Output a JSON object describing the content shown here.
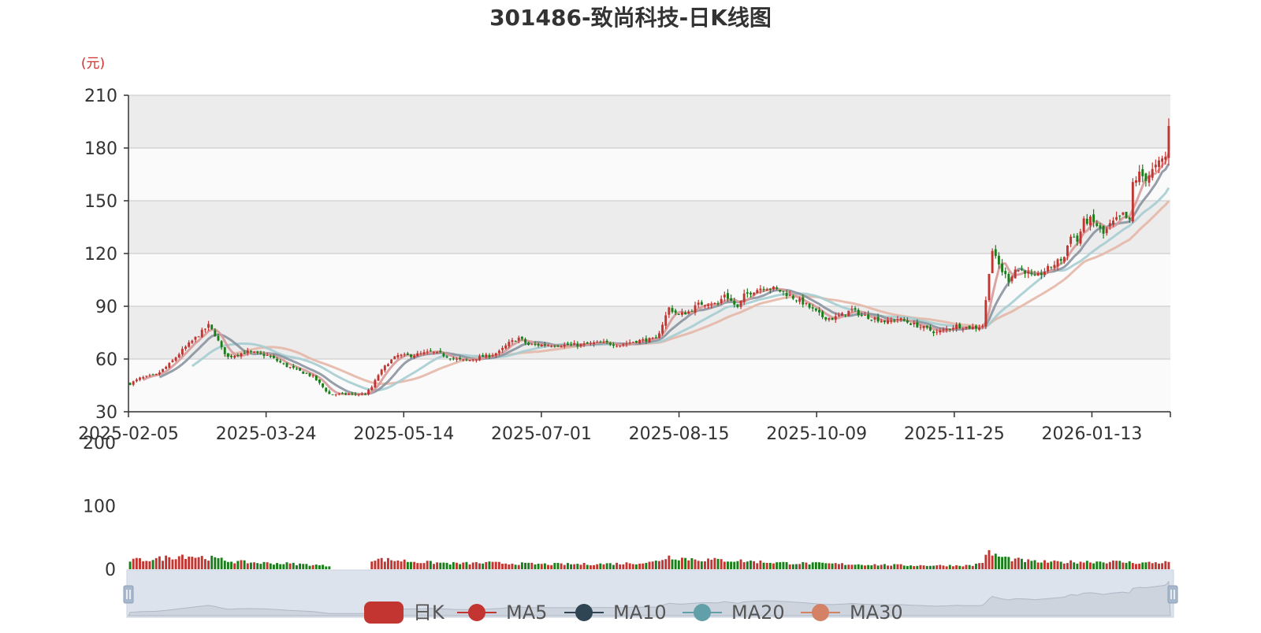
{
  "chart_data": {
    "type": "candlestick",
    "title": "301486-致尚科技-日K线图",
    "unit_label": "(元)",
    "price_axis": {
      "ylim": [
        30,
        210
      ],
      "ticks": [
        30,
        60,
        90,
        120,
        150,
        180,
        210
      ]
    },
    "volume_axis": {
      "ylim": [
        0,
        200
      ],
      "ticks": [
        0,
        100,
        200
      ]
    },
    "x_ticks": [
      "2025-02-05",
      "2025-03-24",
      "2025-05-14",
      "2025-07-01",
      "2025-08-15",
      "2025-10-09",
      "2025-11-25",
      "2026-01-13"
    ],
    "anchors": [
      [
        0,
        46
      ],
      [
        3,
        49
      ],
      [
        8,
        51
      ],
      [
        12,
        57
      ],
      [
        16,
        65
      ],
      [
        20,
        72
      ],
      [
        24,
        79
      ],
      [
        26,
        74
      ],
      [
        28,
        66
      ],
      [
        30,
        61
      ],
      [
        33,
        63
      ],
      [
        36,
        64
      ],
      [
        39,
        63
      ],
      [
        42,
        62
      ],
      [
        45,
        59
      ],
      [
        48,
        56
      ],
      [
        52,
        53
      ],
      [
        56,
        50
      ],
      [
        59,
        44
      ],
      [
        61,
        40
      ],
      [
        64,
        40
      ],
      [
        68,
        40
      ],
      [
        72,
        40
      ],
      [
        74,
        44
      ],
      [
        76,
        51
      ],
      [
        79,
        58
      ],
      [
        82,
        62
      ],
      [
        86,
        62
      ],
      [
        89,
        63
      ],
      [
        92,
        64
      ],
      [
        95,
        63
      ],
      [
        99,
        60
      ],
      [
        103,
        59
      ],
      [
        107,
        61
      ],
      [
        110,
        62
      ],
      [
        113,
        64
      ],
      [
        116,
        69
      ],
      [
        119,
        72
      ],
      [
        122,
        68
      ],
      [
        126,
        68
      ],
      [
        130,
        68
      ],
      [
        134,
        68
      ],
      [
        138,
        68
      ],
      [
        142,
        69
      ],
      [
        146,
        69
      ],
      [
        150,
        68
      ],
      [
        154,
        70
      ],
      [
        158,
        71
      ],
      [
        161,
        71
      ],
      [
        163,
        80
      ],
      [
        165,
        89
      ],
      [
        168,
        85
      ],
      [
        171,
        87
      ],
      [
        174,
        91
      ],
      [
        177,
        92
      ],
      [
        180,
        91
      ],
      [
        182,
        97
      ],
      [
        184,
        93
      ],
      [
        186,
        89
      ],
      [
        188,
        96
      ],
      [
        191,
        99
      ],
      [
        194,
        101
      ],
      [
        197,
        100
      ],
      [
        200,
        98
      ],
      [
        203,
        95
      ],
      [
        206,
        92
      ],
      [
        209,
        88
      ],
      [
        212,
        84
      ],
      [
        215,
        83
      ],
      [
        218,
        85
      ],
      [
        221,
        88
      ],
      [
        224,
        85
      ],
      [
        228,
        83
      ],
      [
        232,
        81
      ],
      [
        235,
        83
      ],
      [
        238,
        81
      ],
      [
        241,
        79
      ],
      [
        244,
        77
      ],
      [
        247,
        75
      ],
      [
        250,
        77
      ],
      [
        253,
        79
      ],
      [
        256,
        78
      ],
      [
        259,
        78
      ],
      [
        261,
        79
      ],
      [
        262,
        93
      ],
      [
        263,
        110
      ],
      [
        264,
        122
      ],
      [
        265,
        117
      ],
      [
        267,
        110
      ],
      [
        269,
        105
      ],
      [
        271,
        111
      ],
      [
        274,
        110
      ],
      [
        277,
        106
      ],
      [
        280,
        110
      ],
      [
        283,
        114
      ],
      [
        286,
        118
      ],
      [
        288,
        131
      ],
      [
        290,
        127
      ],
      [
        292,
        138
      ],
      [
        294,
        139
      ],
      [
        296,
        136
      ],
      [
        298,
        131
      ],
      [
        300,
        136
      ],
      [
        302,
        139
      ],
      [
        304,
        142
      ],
      [
        306,
        138
      ],
      [
        307,
        160
      ],
      [
        309,
        165
      ],
      [
        311,
        163
      ],
      [
        313,
        167
      ],
      [
        315,
        171
      ],
      [
        317,
        175
      ],
      [
        318,
        192
      ]
    ],
    "volume_anchors": [
      [
        0,
        14
      ],
      [
        8,
        16
      ],
      [
        16,
        22
      ],
      [
        24,
        18
      ],
      [
        32,
        12
      ],
      [
        40,
        10
      ],
      [
        48,
        9
      ],
      [
        56,
        7
      ],
      [
        61,
        5
      ],
      [
        62,
        0
      ],
      [
        73,
        0
      ],
      [
        74,
        16
      ],
      [
        82,
        14
      ],
      [
        90,
        11
      ],
      [
        100,
        9
      ],
      [
        110,
        10
      ],
      [
        118,
        9
      ],
      [
        126,
        8
      ],
      [
        140,
        8
      ],
      [
        150,
        9
      ],
      [
        160,
        11
      ],
      [
        165,
        20
      ],
      [
        170,
        17
      ],
      [
        176,
        15
      ],
      [
        184,
        14
      ],
      [
        192,
        12
      ],
      [
        200,
        10
      ],
      [
        210,
        9
      ],
      [
        220,
        8
      ],
      [
        230,
        7
      ],
      [
        240,
        6
      ],
      [
        250,
        6
      ],
      [
        258,
        6
      ],
      [
        261,
        12
      ],
      [
        263,
        26
      ],
      [
        266,
        20
      ],
      [
        270,
        16
      ],
      [
        276,
        12
      ],
      [
        284,
        11
      ],
      [
        292,
        12
      ],
      [
        300,
        12
      ],
      [
        310,
        10
      ],
      [
        318,
        11
      ]
    ],
    "colors": {
      "up": "#c23531",
      "down": "#1a7e1a",
      "ma5": "#d79a9a",
      "ma10": "#8a94a0",
      "ma20": "#a6cdd2",
      "ma30": "#e4b7a7",
      "panel_band_a": "#ececec",
      "panel_band_b": "#fafafa",
      "unit_label": "#d0302c",
      "slider_fill": "#dde3ed",
      "slider_border": "#a7b7cc"
    },
    "legend": {
      "position": "bottom-center",
      "items": [
        {
          "label": "日K",
          "color": "#c23531",
          "icon": "rounded-rect-icon"
        },
        {
          "label": "MA5",
          "color": "#c23531",
          "icon": "circle-line-icon"
        },
        {
          "label": "MA10",
          "color": "#2f4554",
          "icon": "circle-line-icon"
        },
        {
          "label": "MA20",
          "color": "#61a0a8",
          "icon": "circle-line-icon"
        },
        {
          "label": "MA30",
          "color": "#d48265",
          "icon": "circle-line-icon"
        }
      ]
    }
  }
}
